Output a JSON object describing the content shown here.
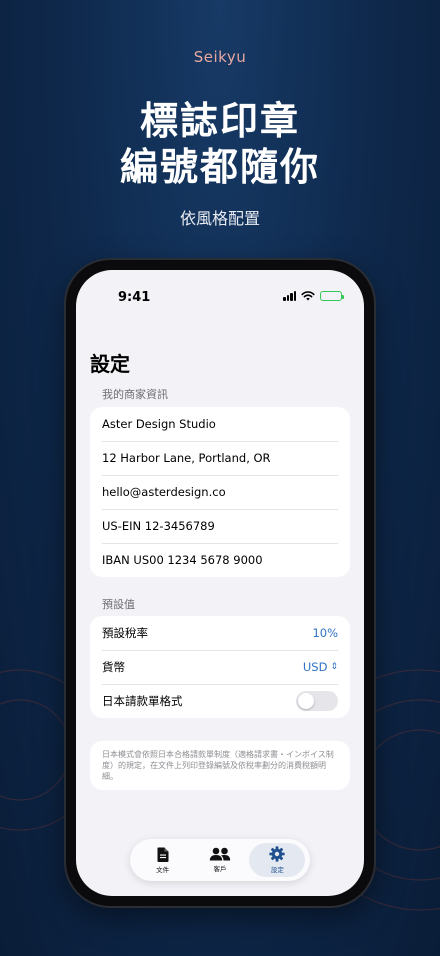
{
  "promo": {
    "app_name": "Seikyu",
    "headline_line1": "標誌印章",
    "headline_line2": "編號都隨你",
    "subheadline": "依風格配置"
  },
  "status_bar": {
    "time": "9:41"
  },
  "settings": {
    "title": "設定",
    "merchant_section": {
      "header": "我的商家資訊",
      "rows": [
        "Aster Design Studio",
        "12 Harbor Lane, Portland, OR",
        "hello@asterdesign.co",
        "US-EIN 12-3456789",
        "IBAN US00 1234 5678 9000"
      ]
    },
    "defaults_section": {
      "header": "預設值",
      "tax_label": "預設稅率",
      "tax_value": "10%",
      "currency_label": "貨幣",
      "currency_value": "USD",
      "japan_format_label": "日本請款單格式",
      "japan_format_enabled": false
    },
    "note": "日本模式會依照日本合格請款單制度（適格請求書・インボイス制度）的規定，在文件上列印登錄編號及依稅率劃分的消費稅額明細。"
  },
  "tab_bar": {
    "tabs": [
      {
        "label": "文件",
        "icon": "document-icon",
        "active": false
      },
      {
        "label": "客戶",
        "icon": "people-icon",
        "active": false
      },
      {
        "label": "設定",
        "icon": "gear-icon",
        "active": true
      }
    ]
  },
  "colors": {
    "accent": "#2f73c4",
    "background": "#0f2a4e",
    "app_name": "#e7a7a0"
  }
}
